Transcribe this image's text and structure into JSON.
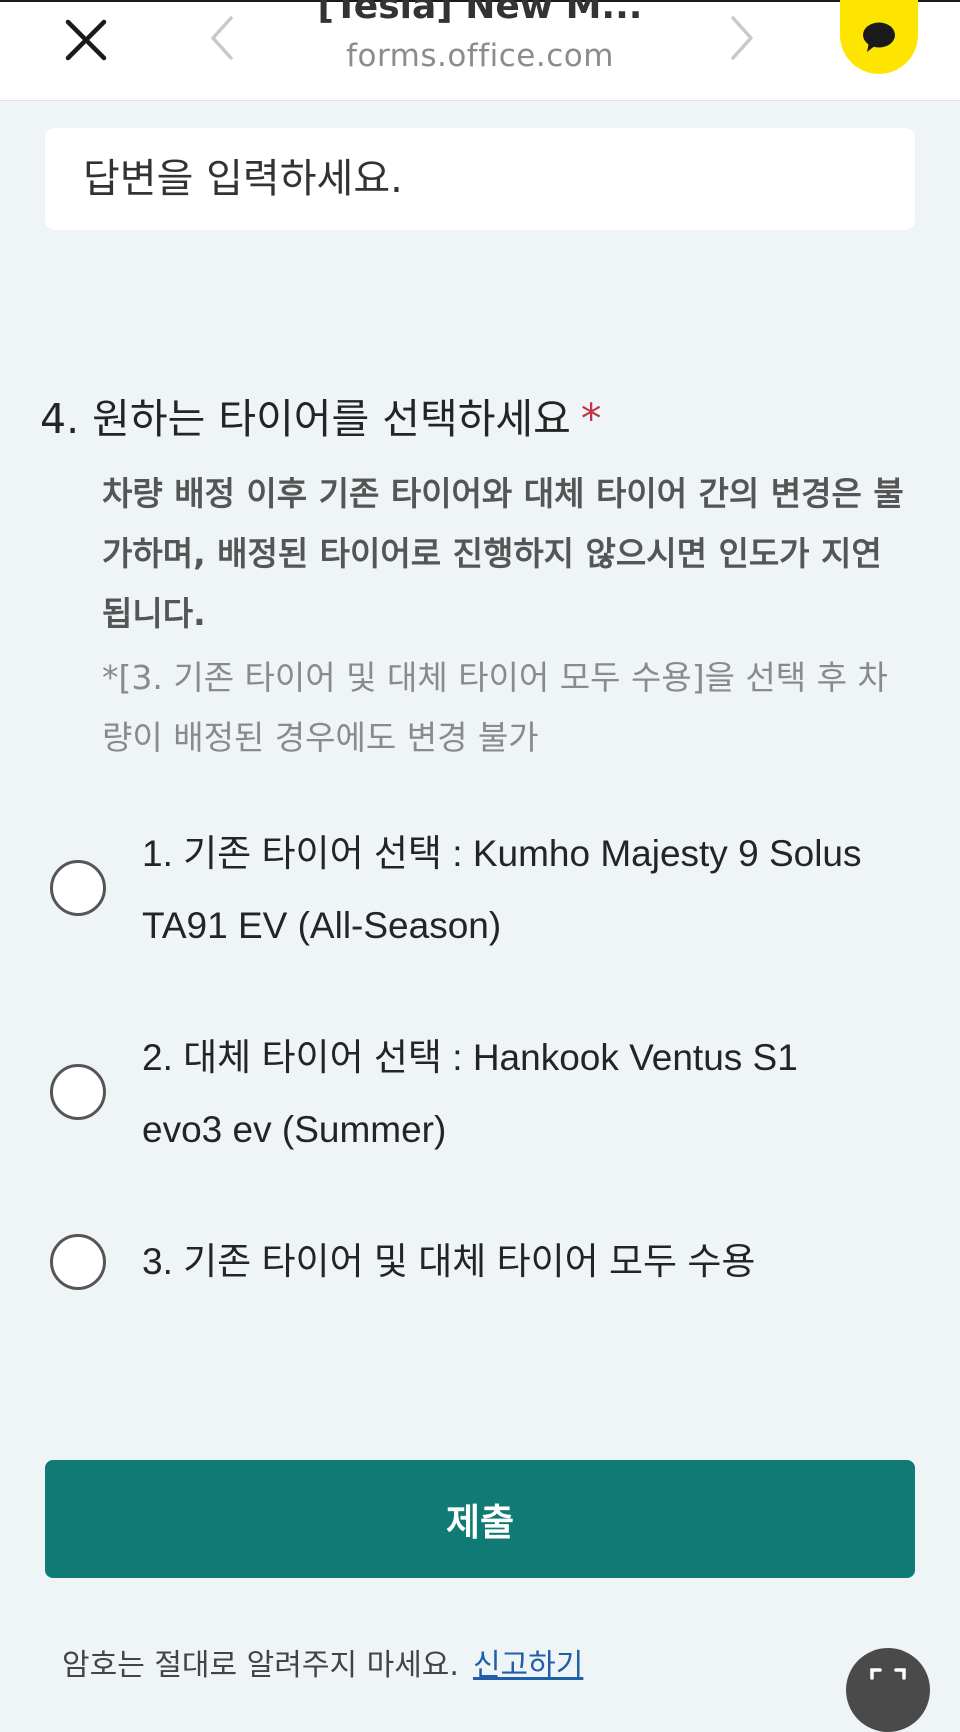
{
  "browser": {
    "title": "[Tesla] New M...",
    "url": "forms.office.com",
    "close_icon": "close-icon",
    "back_icon": "chevron-left-icon",
    "forward_icon": "chevron-right-icon",
    "chat_icon": "kakao-chat-icon"
  },
  "answer": {
    "placeholder": "답변을 입력하세요.",
    "value": ""
  },
  "question": {
    "number": "4.",
    "title": "원하는 타이어를 선택하세요",
    "required_mark": "*",
    "note_bold": "차량 배정 이후 기존 타이어와 대체 타이어 간의 변경은 불가하며, 배정된 타이어로 진행하지 않으시면 인도가 지연됩니다.",
    "note_light": "*[3. 기존 타이어 및 대체 타이어 모두 수용]을 선택 후 차량이 배정된 경우에도 변경 불가",
    "options": [
      {
        "label": "1. 기존 타이어 선택 : Kumho Majesty 9 Solus TA91 EV (All-Season)",
        "selected": false
      },
      {
        "label": "2. 대체 타이어 선택 : Hankook Ventus S1 evo3 ev (Summer)",
        "selected": false
      },
      {
        "label": "3. 기존 타이어 및 대체 타이어 모두 수용",
        "selected": false
      }
    ]
  },
  "submit": {
    "label": "제출"
  },
  "footer": {
    "notice": "암호는 절대로 알려주지 마세요.",
    "report_link": "신고하기"
  },
  "colors": {
    "page_bg": "#eff4f7",
    "accent": "#0f7b74",
    "required": "#c4314b",
    "kakao": "#fee500",
    "link": "#1f5fa8"
  }
}
